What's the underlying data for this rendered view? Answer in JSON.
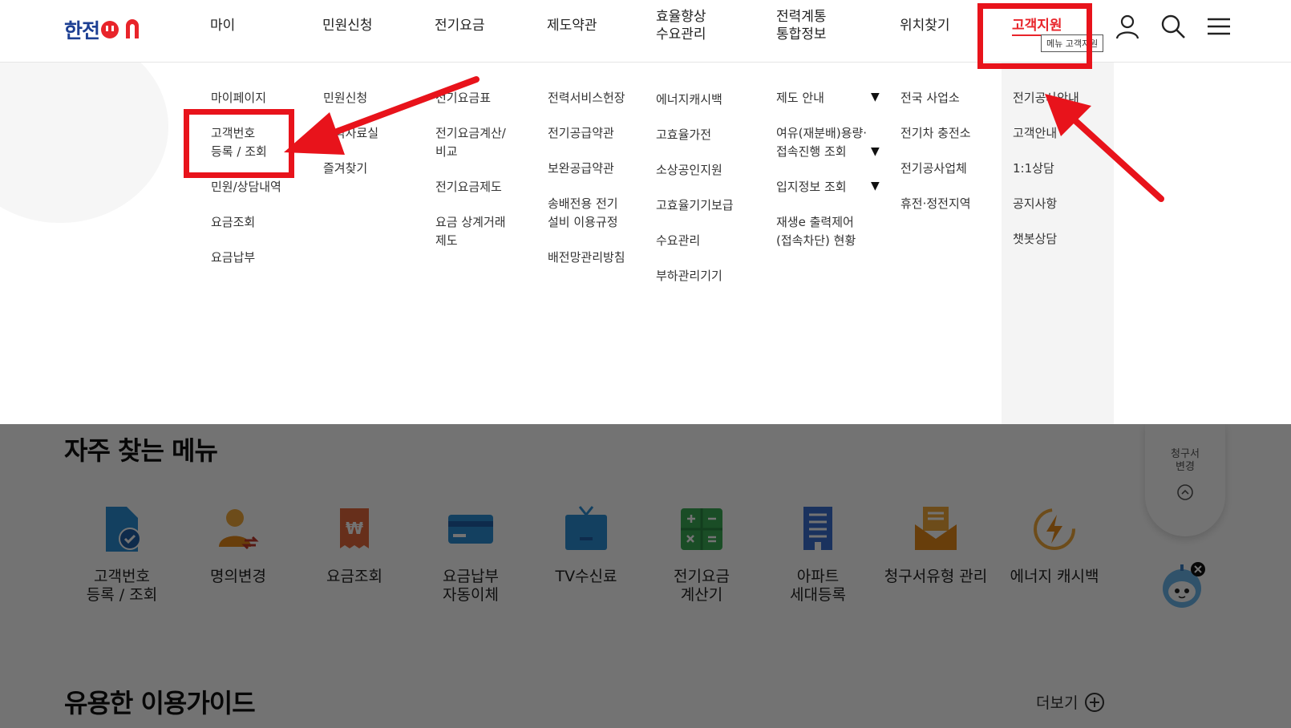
{
  "header": {
    "logo": {
      "text_kr": "한전",
      "text_on": "ON"
    },
    "nav": [
      {
        "label": "마이"
      },
      {
        "label": "민원신청"
      },
      {
        "label": "전기요금"
      },
      {
        "label": "제도약관"
      },
      {
        "label": "효율향상\n수요관리"
      },
      {
        "label": "전력계통\n통합정보"
      },
      {
        "label": "위치찾기"
      },
      {
        "label": "고객지원"
      }
    ],
    "tooltip": "메뉴 고객지원"
  },
  "mega_menu": {
    "col_my": [
      "마이페이지",
      "고객번호\n등록 / 조회",
      "민원/상담내역",
      "요금조회",
      "요금납부"
    ],
    "col_civil": [
      "민원신청",
      "서식자료실",
      "즐겨찾기"
    ],
    "col_fee": [
      "전기요금표",
      "전기요금계산/\n비교",
      "전기요금제도",
      "요금 상계거래\n제도"
    ],
    "col_terms": [
      "전력서비스헌장",
      "전기공급약관",
      "보완공급약관",
      "송배전용 전기\n설비 이용규정",
      "배전망관리방침"
    ],
    "col_eff": [
      "에너지캐시백",
      "고효율가전",
      "소상공인지원",
      "고효율기기보급",
      "수요관리",
      "부하관리기기"
    ],
    "col_grid": [
      "제도 안내",
      "여유(재분배)용량·\n접속진행 조회",
      "입지정보 조회",
      "재생e 출력제어\n(접속차단) 현황"
    ],
    "col_loc": [
      "전국 사업소",
      "전기차 충전소",
      "전기공사업체",
      "휴전·정전지역"
    ],
    "col_support": [
      "전기공사안내",
      "고객안내",
      "1:1상담",
      "공지사항",
      "챗봇상담"
    ],
    "expand_glyph": "▼"
  },
  "content": {
    "frequent_title": "자주 찾는 메뉴",
    "quick_menu": [
      {
        "label": "고객번호\n등록 / 조회",
        "icon": "document-check-icon"
      },
      {
        "label": "명의변경",
        "icon": "person-swap-icon"
      },
      {
        "label": "요금조회",
        "icon": "won-bill-icon"
      },
      {
        "label": "요금납부\n자동이체",
        "icon": "credit-card-icon"
      },
      {
        "label": "TV수신료",
        "icon": "tv-icon"
      },
      {
        "label": "전기요금\n계산기",
        "icon": "calculator-icon"
      },
      {
        "label": "아파트\n세대등록",
        "icon": "apartment-icon"
      },
      {
        "label": "청구서유형 관리",
        "icon": "mail-bill-icon"
      },
      {
        "label": "에너지 캐시백",
        "icon": "energy-bolt-icon"
      }
    ],
    "guide_title": "유용한 이용가이드",
    "more_label": "더보기",
    "side_float_label": "청구서\n변경"
  },
  "colors": {
    "brand_blue": "#1d3f93",
    "brand_red": "#e8242a",
    "annotation_red": "#e8131b"
  }
}
